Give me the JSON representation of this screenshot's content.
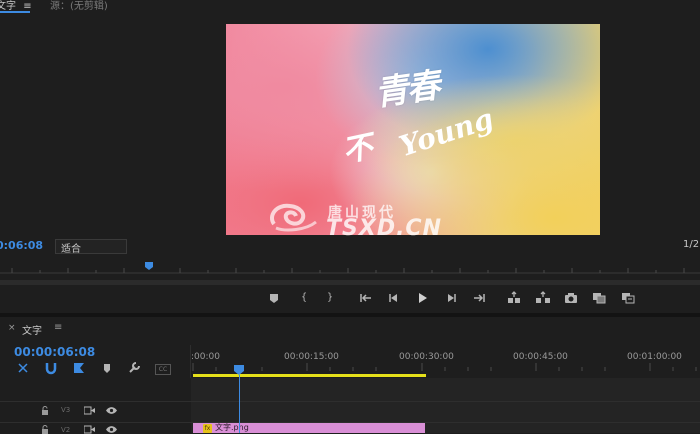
{
  "monitor": {
    "tab_active": "文字",
    "tab_menu": "≡",
    "tab_source": "源：(无剪辑)",
    "timecode": "0:06:08",
    "fit_value": "适合",
    "resolution": "1/2"
  },
  "video": {
    "title_line1": "青春",
    "title_line2": "不",
    "title_line3": "Young",
    "watermark_cn": "唐山现代",
    "watermark_en": "TSXD.CN"
  },
  "timeline": {
    "close": "×",
    "sequence_name": "文字",
    "menu": "≡",
    "timecode": "00:00:06:08",
    "cc_label": "CC",
    "ticks": [
      ":00:00",
      "00:00:15:00",
      "00:00:30:00",
      "00:00:45:00",
      "00:01:00:00"
    ],
    "tracks": [
      {
        "label": "V3"
      },
      {
        "label": "V2"
      }
    ],
    "clip": {
      "fx": "fx",
      "name": "文字.png"
    }
  }
}
